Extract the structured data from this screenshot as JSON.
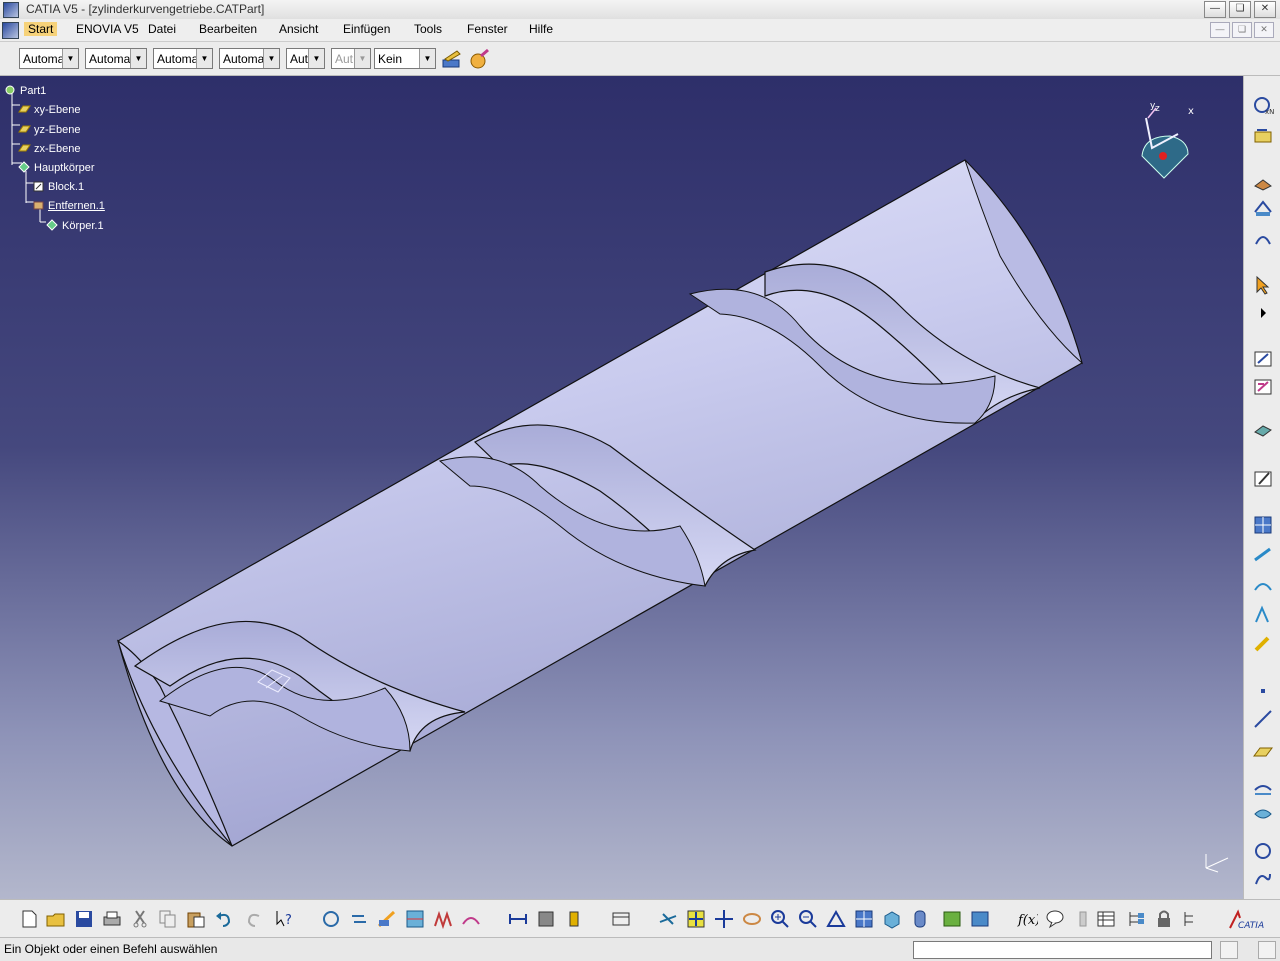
{
  "window": {
    "title": "CATIA V5 - [zylinderkurvengetriebe.CATPart]",
    "buttons": [
      "minimize",
      "restore",
      "close"
    ]
  },
  "menubar": {
    "items": [
      {
        "label": "Start",
        "underline": "S",
        "active": true
      },
      {
        "label": "ENOVIA V5"
      },
      {
        "label": "Datei",
        "underline": "D"
      },
      {
        "label": "Bearbeiten",
        "underline": "B"
      },
      {
        "label": "Ansicht",
        "underline": "A"
      },
      {
        "label": "Einfügen",
        "underline": "E"
      },
      {
        "label": "Tools",
        "underline": "T"
      },
      {
        "label": "Fenster",
        "underline": "F"
      },
      {
        "label": "Hilfe",
        "underline": "H"
      }
    ]
  },
  "properties_toolbar": {
    "combos": [
      {
        "value": "Automa"
      },
      {
        "value": "Automa"
      },
      {
        "value": "Automa"
      },
      {
        "value": "Automa"
      },
      {
        "value": "Aut"
      },
      {
        "value": "Aut",
        "disabled": true
      },
      {
        "value": "Kein"
      }
    ],
    "icons": [
      "painter-icon",
      "graphic-properties-icon"
    ]
  },
  "tree": {
    "items": [
      {
        "label": "Part1",
        "icon": "part-icon"
      },
      {
        "label": "xy-Ebene",
        "icon": "plane-icon"
      },
      {
        "label": "yz-Ebene",
        "icon": "plane-icon"
      },
      {
        "label": "zx-Ebene",
        "icon": "plane-icon"
      },
      {
        "label": "Hauptkörper",
        "icon": "body-icon"
      },
      {
        "label": "Block.1",
        "icon": "pad-icon"
      },
      {
        "label": "Entfernen.1",
        "icon": "remove-icon",
        "underlined": true
      },
      {
        "label": "Körper.1",
        "icon": "body-icon"
      }
    ]
  },
  "compass": {
    "x_label": "x",
    "y_label": "y",
    "z_label": "z"
  },
  "status": {
    "message": "Ein Objekt oder einen Befehl auswählen",
    "command_input": ""
  },
  "colors": {
    "bg_top": "#2e2f6a",
    "bg_bottom": "#b3b7cc",
    "part_fill": "#c7c8ec",
    "toolbar_bg": "#ececec",
    "active_menu": "#f6d27a"
  },
  "right_toolbar_icons": [
    "sketch-icon",
    "sketch-positioned-icon",
    "axis-system-icon",
    "plane-system-icon",
    "plane-offset-icon",
    "select-icon",
    "expand-arrow-icon",
    "sketcher-icon",
    "sketch-analysis-icon",
    "part-design-icon",
    "edit-sketch-icon",
    "grid-icon",
    "snap-icon",
    "construction-icon",
    "dimension-icon",
    "geometric-constraint-icon",
    "point-icon",
    "line-icon",
    "plane-icon",
    "surface-icon",
    "sweep-icon",
    "circle-icon",
    "spline-icon"
  ],
  "bottom_toolbar_icons": [
    "new-icon",
    "open-icon",
    "save-icon",
    "print-icon",
    "cut-icon",
    "copy-icon",
    "paste-icon",
    "undo-icon",
    "redo-icon",
    "whats-this-icon",
    "update-icon",
    "replace-icon",
    "scan-icon",
    "curvature-icon",
    "draft-analysis-icon",
    "porcupine-icon",
    "measure-between-icon",
    "measure-item-icon",
    "measure-inertia-icon",
    "catalog-icon",
    "fly-mode-icon",
    "fit-all-icon",
    "pan-icon",
    "rotate-icon",
    "zoom-in-icon",
    "zoom-out-icon",
    "normal-view-icon",
    "multi-view-icon",
    "iso-view-icon",
    "view-mode-icon",
    "hide-show-icon",
    "swap-space-icon",
    "formula-icon",
    "comment-icon",
    "knowledge-icon",
    "table-icon",
    "tree-icon",
    "lock-icon",
    "parameter-icon",
    "catia-logo"
  ]
}
